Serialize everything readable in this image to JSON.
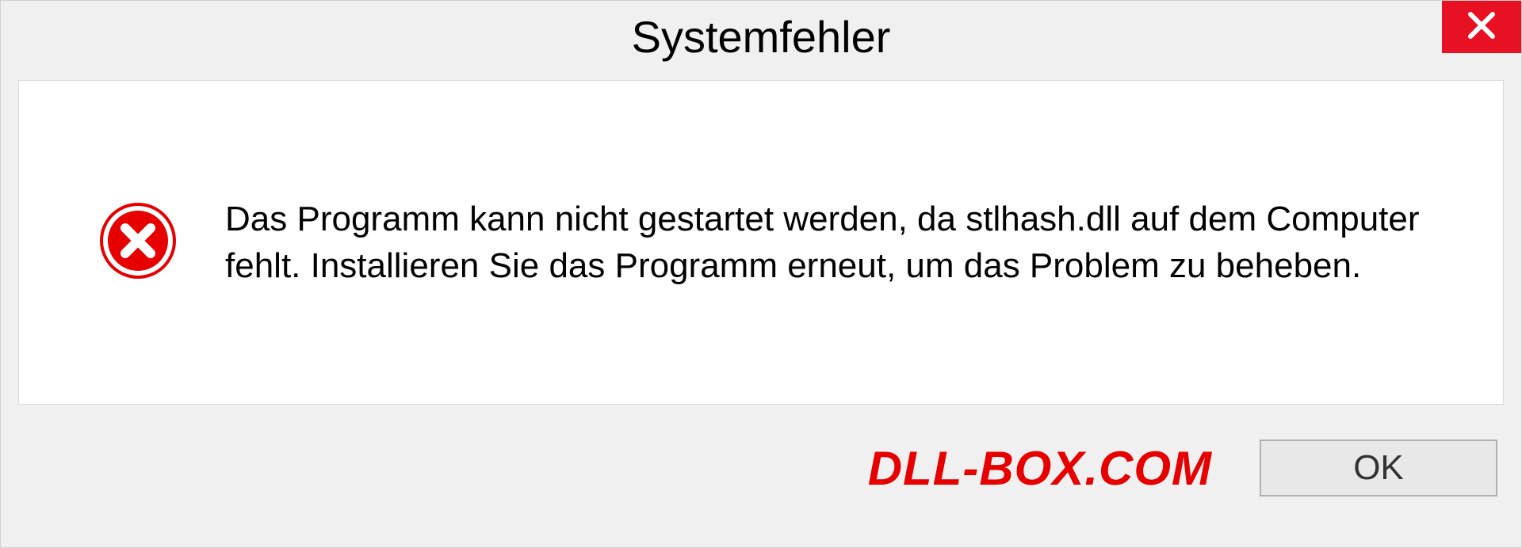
{
  "dialog": {
    "title": "Systemfehler",
    "message": "Das Programm kann nicht gestartet werden, da stlhash.dll auf dem Computer fehlt. Installieren Sie das Programm erneut, um das Problem zu beheben.",
    "ok_label": "OK"
  },
  "watermark": "DLL-BOX.COM"
}
